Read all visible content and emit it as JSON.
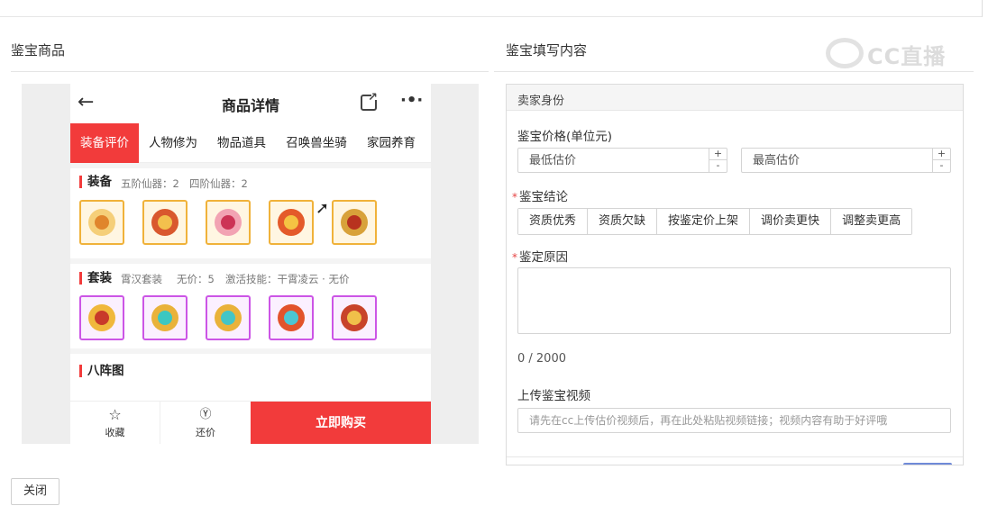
{
  "left_panel": {
    "title": "鉴宝商品"
  },
  "right_panel": {
    "title": "鉴宝填写内容"
  },
  "watermark": {
    "text": "CC直播"
  },
  "phone": {
    "header_title": "商品详情",
    "tabs": [
      "装备评价",
      "人物修为",
      "物品道具",
      "召唤兽坐骑",
      "家园养育"
    ],
    "active_tab": "装备评价",
    "equip": {
      "title": "装备",
      "stat1": "五阶仙器：2",
      "stat2": "四阶仙器：2",
      "item_count": 5
    },
    "set": {
      "title": "套装",
      "s1": "霄汉套装",
      "s2": "无价：5",
      "s3": "激活技能：干霄凌云 · 无价",
      "item_count": 5
    },
    "bazhen": {
      "title": "八阵图"
    },
    "bottom": {
      "fav": "收藏",
      "bargain": "还价",
      "buy": "立即购买"
    }
  },
  "form": {
    "section_header": "卖家身份",
    "price_label": "鉴宝价格(单位元)",
    "min_placeholder": "最低估价",
    "max_placeholder": "最高估价",
    "stepper_up": "+",
    "stepper_down": "-",
    "conclusion_label": "鉴宝结论",
    "conclusion_options": [
      "资质优秀",
      "资质欠缺",
      "按鉴定价上架",
      "调价卖更快",
      "调整卖更高"
    ],
    "reason_label": "鉴定原因",
    "counter": "0 / 2000",
    "video_label": "上传鉴宝视频",
    "video_placeholder": "请先在cc上传估价视频后，再在此处粘贴视频链接；视频内容有助于好评哦"
  },
  "footer": {
    "close_label": "关闭"
  },
  "colors": {
    "accent_red": "#f23b3b",
    "gold_border": "#f0b23a",
    "purple_border": "#cc55e6"
  }
}
